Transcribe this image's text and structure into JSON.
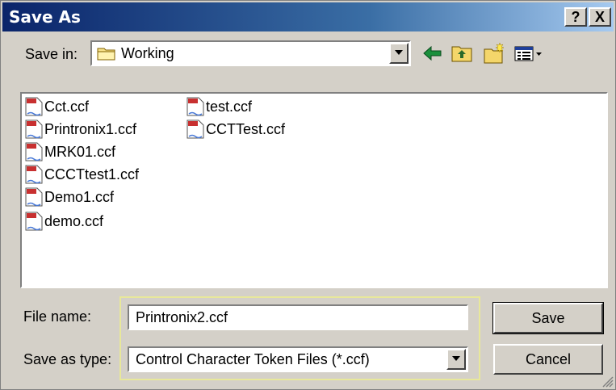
{
  "window": {
    "title": "Save As",
    "help_label": "?",
    "close_label": "X"
  },
  "save_in": {
    "label": "Save in:",
    "value": "Working"
  },
  "toolbar": {
    "icons": [
      "back-arrow-icon",
      "up-folder-icon",
      "new-folder-icon",
      "view-menu-icon"
    ]
  },
  "files": [
    "Cct.ccf",
    "Printronix1.ccf",
    "MRK01.ccf",
    "CCCTtest1.ccf",
    "Demo1.ccf",
    "demo.ccf",
    "test.ccf",
    "CCTTest.ccf"
  ],
  "filename": {
    "label": "File name:",
    "value": "Printronix2.ccf"
  },
  "filetype": {
    "label": "Save as type:",
    "value": "Control Character Token Files (*.ccf)"
  },
  "buttons": {
    "save": "Save",
    "cancel": "Cancel"
  }
}
